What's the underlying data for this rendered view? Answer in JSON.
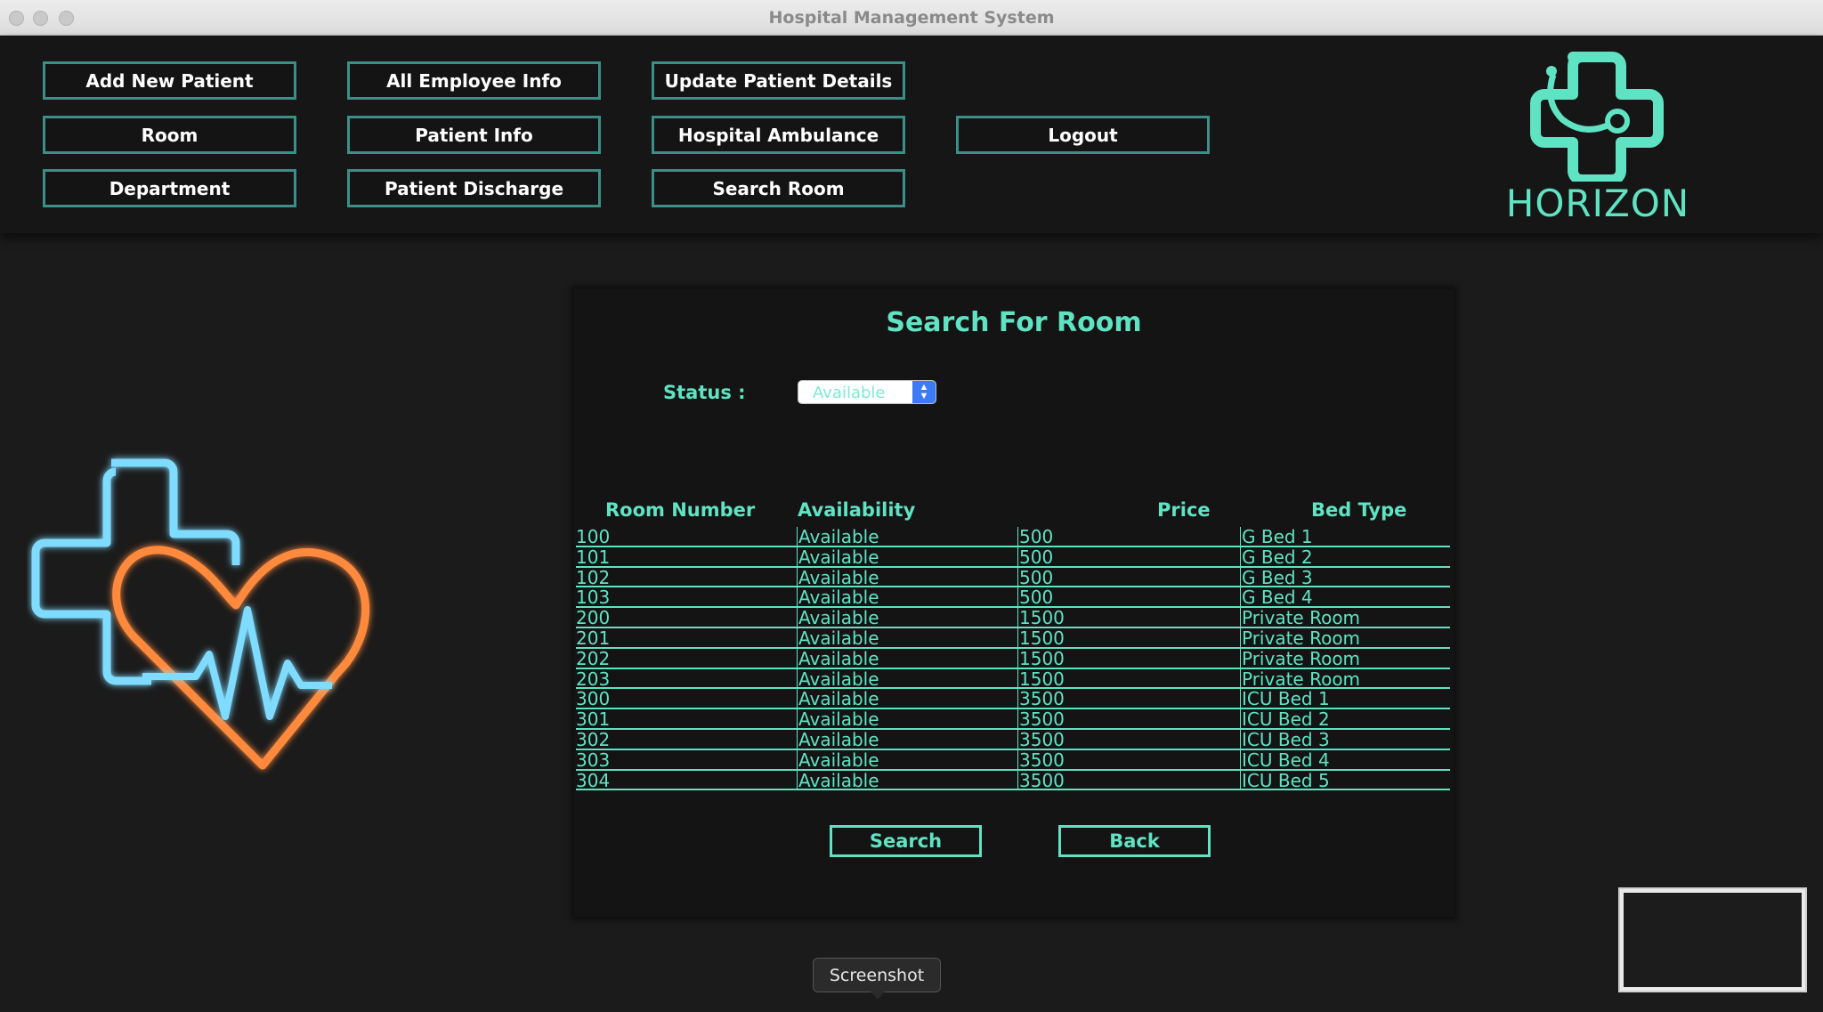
{
  "window": {
    "title": "Hospital Management System"
  },
  "nav": {
    "add_new_patient": "Add New Patient",
    "all_employee_info": "All Employee Info",
    "update_patient_details": "Update Patient Details",
    "room": "Room",
    "patient_info": "Patient Info",
    "hospital_ambulance": "Hospital Ambulance",
    "logout": "Logout",
    "department": "Department",
    "patient_discharge": "Patient Discharge",
    "search_room": "Search Room"
  },
  "logo": {
    "text": "HORIZON",
    "color": "#5fe3c3"
  },
  "search_panel": {
    "title": "Search For Room",
    "status_label": "Status :",
    "status_value": "Available",
    "columns": [
      "Room Number",
      "Availability",
      "Price",
      "Bed Type"
    ],
    "rows": [
      [
        "100",
        "Available",
        "500",
        "G Bed 1"
      ],
      [
        "101",
        "Available",
        "500",
        "G Bed 2"
      ],
      [
        "102",
        "Available",
        "500",
        "G Bed 3"
      ],
      [
        "103",
        "Available",
        "500",
        "G Bed 4"
      ],
      [
        "200",
        "Available",
        "1500",
        "Private Room"
      ],
      [
        "201",
        "Available",
        "1500",
        "Private Room"
      ],
      [
        "202",
        "Available",
        "1500",
        "Private Room"
      ],
      [
        "203",
        "Available",
        "1500",
        "Private Room"
      ],
      [
        "300",
        "Available",
        "3500",
        "ICU Bed 1"
      ],
      [
        "301",
        "Available",
        "3500",
        "ICU Bed 2"
      ],
      [
        "302",
        "Available",
        "3500",
        "ICU Bed 3"
      ],
      [
        "303",
        "Available",
        "3500",
        "ICU Bed 4"
      ],
      [
        "304",
        "Available",
        "3500",
        "ICU Bed 5"
      ]
    ],
    "search_button": "Search",
    "back_button": "Back"
  },
  "tooltip": {
    "text": "Screenshot"
  },
  "colors": {
    "accent": "#5fe3c3",
    "button_border": "#3c8f86",
    "background": "#1b1b1b"
  }
}
